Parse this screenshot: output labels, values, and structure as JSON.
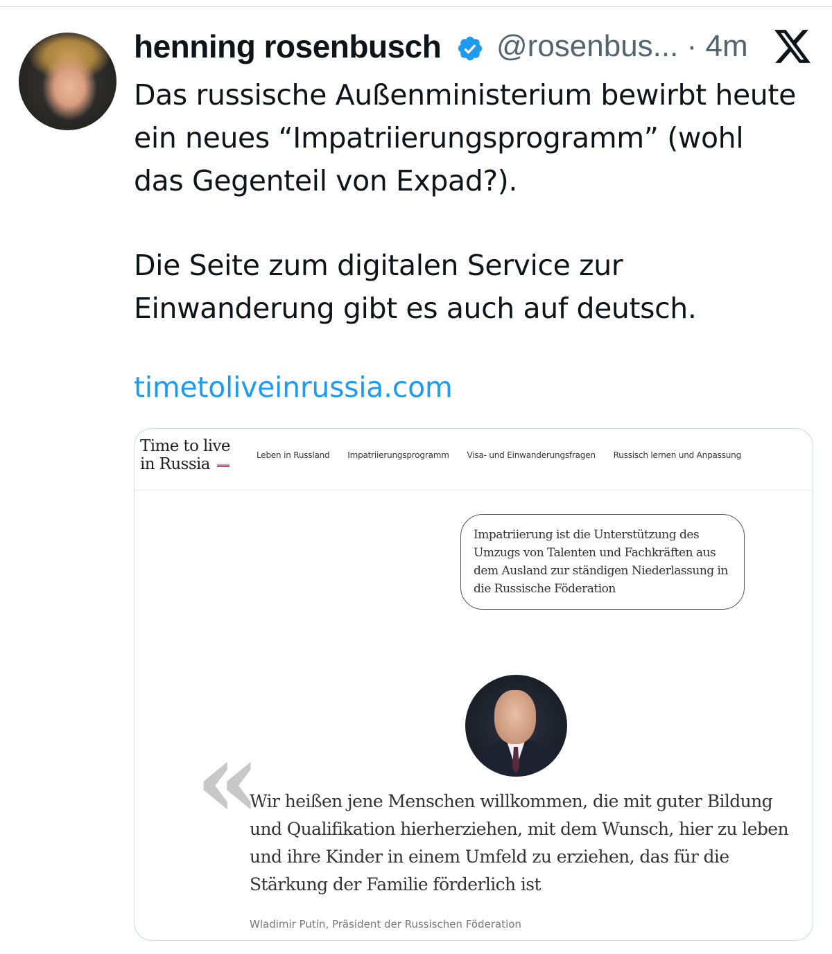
{
  "tweet": {
    "author_name": "henning rosenbusch",
    "handle": "@rosenbus...",
    "separator": "·",
    "time": "4m",
    "platform_icon": "x-logo-icon",
    "verified_icon": "verified-badge-icon",
    "paragraph_1": "Das russische Außenministerium bewirbt heute ein neues “Impatriierungsprogramm” (wohl das Gegenteil von Expad?).",
    "paragraph_2": "Die Seite zum digitalen Service zur Einwanderung gibt es auch auf deutsch.",
    "link_text": "timetoliveinrussia.com",
    "colors": {
      "text": "#0f1419",
      "secondary": "#536471",
      "link": "#1d9bf0",
      "verified": "#1d9bf0"
    }
  },
  "card": {
    "logo_line_1": "Time to live",
    "logo_line_2": "in Russia",
    "nav": [
      "Leben in Russland",
      "Impatriierungsprogramm",
      "Visa- und Einwanderungsfragen",
      "Russisch lernen und Anpassung"
    ],
    "definition": "Impatriierung ist die Unterstützung des Umzugs von Talenten und Fachkräften aus dem Ausland zur ständigen Niederlassung in die Russische Föderation",
    "quote_mark": "«",
    "quote": "Wir heißen jene Menschen willkommen, die mit guter Bildung und Qualifikation hierherziehen, mit dem Wunsch, hier zu leben und ihre Kinder in einem Umfeld zu erziehen, das für die Stärkung der Familie förderlich ist",
    "quote_author": "Wladimir Putin, Präsident der Russischen Föderation"
  }
}
